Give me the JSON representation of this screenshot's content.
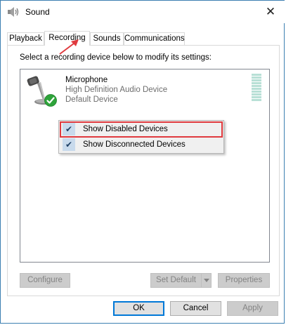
{
  "window": {
    "title": "Sound",
    "close_glyph": "✕"
  },
  "tabs": [
    {
      "label": "Playback",
      "active": false
    },
    {
      "label": "Recording",
      "active": true
    },
    {
      "label": "Sounds",
      "active": false
    },
    {
      "label": "Communications",
      "active": false
    }
  ],
  "instruction": "Select a recording device below to modify its settings:",
  "device": {
    "name": "Microphone",
    "description": "High Definition Audio Device",
    "status": "Default Device",
    "icon": "microphone-icon",
    "badge": "green-check-icon",
    "level": 0
  },
  "context_menu": {
    "items": [
      {
        "label": "Show Disabled Devices",
        "checked": true,
        "highlighted": true
      },
      {
        "label": "Show Disconnected Devices",
        "checked": true,
        "highlighted": false
      }
    ],
    "check_glyph": "✔"
  },
  "panel_buttons": {
    "configure": "Configure",
    "set_default": "Set Default",
    "properties": "Properties"
  },
  "dialog_buttons": {
    "ok": "OK",
    "cancel": "Cancel",
    "apply": "Apply"
  },
  "colors": {
    "annotation_red": "#e03a3e",
    "accent_blue": "#0078d7",
    "check_green": "#2ea43a"
  }
}
